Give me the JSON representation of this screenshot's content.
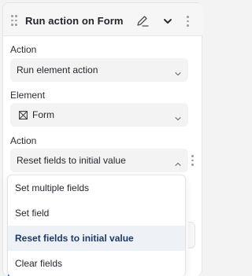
{
  "header": {
    "title": "Run action on Form",
    "icons": [
      "drag-handle-icon",
      "pencil-icon",
      "chevron-down-icon",
      "more-vertical-icon"
    ]
  },
  "fields": {
    "action_label": "Action",
    "action_value": "Run element action",
    "element_label": "Element",
    "element_value": "Form",
    "element_icon": "form-icon",
    "subaction_label": "Action",
    "subaction_value": "Reset fields to initial value"
  },
  "menu": {
    "items": [
      {
        "label": "Set multiple fields",
        "selected": false
      },
      {
        "label": "Set field",
        "selected": false
      },
      {
        "label": "Reset fields to initial value",
        "selected": true
      },
      {
        "label": "Clear fields",
        "selected": false
      }
    ]
  },
  "colors": {
    "selected_text": "#1d3b6a",
    "selected_bg": "#eef1f5",
    "accent": "#3a7bd5"
  }
}
